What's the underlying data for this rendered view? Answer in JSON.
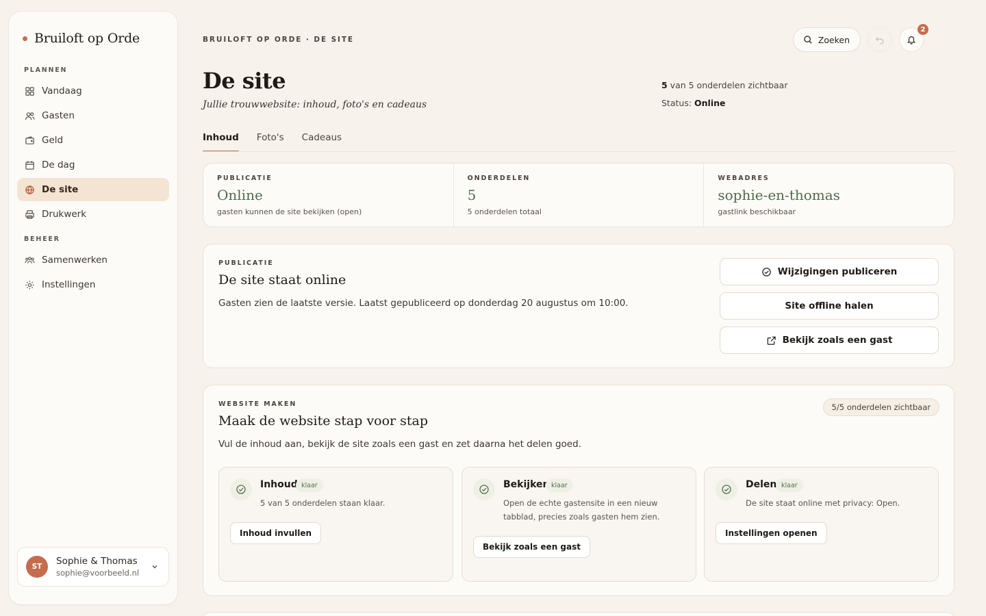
{
  "brand": {
    "name": "Bruiloft op Orde"
  },
  "sidebar": {
    "sections": [
      {
        "label": "PLANNEN",
        "items": [
          {
            "label": "Vandaag",
            "icon": "grid-icon"
          },
          {
            "label": "Gasten",
            "icon": "users-icon"
          },
          {
            "label": "Geld",
            "icon": "wallet-icon"
          },
          {
            "label": "De dag",
            "icon": "calendar-icon"
          },
          {
            "label": "De site",
            "icon": "globe-icon",
            "active": true
          },
          {
            "label": "Drukwerk",
            "icon": "printer-icon"
          }
        ]
      },
      {
        "label": "BEHEER",
        "items": [
          {
            "label": "Samenwerken",
            "icon": "team-icon"
          },
          {
            "label": "Instellingen",
            "icon": "gear-icon"
          }
        ]
      }
    ],
    "user": {
      "initials": "ST",
      "name": "Sophie & Thomas",
      "email": "sophie@voorbeeld.nl"
    }
  },
  "header": {
    "breadcrumb": "BRUILOFT OP ORDE · DE SITE",
    "title": "De site",
    "subtitle": "Jullie trouwwebsite: inhoud, foto's en cadeaus",
    "visible_count_strong": "5",
    "visible_count_rest": " van 5 onderdelen zichtbaar",
    "status_label": "Status: ",
    "status_value": "Online",
    "search_label": "Zoeken",
    "notification_count": "2"
  },
  "tabs": [
    {
      "label": "Inhoud",
      "active": true
    },
    {
      "label": "Foto's",
      "active": false
    },
    {
      "label": "Cadeaus",
      "active": false
    }
  ],
  "stats": [
    {
      "label": "PUBLICATIE",
      "value": "Online",
      "note": "gasten kunnen de site bekijken (open)"
    },
    {
      "label": "ONDERDELEN",
      "value": "5",
      "note": "5 onderdelen totaal"
    },
    {
      "label": "WEBADRES",
      "value": "sophie-en-thomas",
      "note": "gastlink beschikbaar"
    }
  ],
  "publication": {
    "label": "PUBLICATIE",
    "title": "De site staat online",
    "description": "Gasten zien de laatste versie. Laatst gepubliceerd op donderdag 20 augustus om 10:00.",
    "publish_button": "Wijzigingen publiceren",
    "offline_button": "Site offline halen",
    "preview_button": "Bekijk zoals een gast"
  },
  "builder": {
    "label": "WEBSITE MAKEN",
    "title": "Maak de website stap voor stap",
    "description": "Vul de inhoud aan, bekijk de site zoals een gast en zet daarna het delen goed.",
    "pill": "5/5 onderdelen zichtbaar",
    "steps": [
      {
        "title": "Inhoud",
        "tag": "klaar",
        "description": "5 van 5 onderdelen staan klaar.",
        "button": "Inhoud invullen"
      },
      {
        "title": "Bekijken",
        "tag": "klaar",
        "description": "Open de echte gastensite in een nieuw tabblad, precies zoals gasten hem zien.",
        "button": "Bekijk zoals een gast"
      },
      {
        "title": "Delen",
        "tag": "klaar",
        "description": "De site staat online met privacy: Open.",
        "button": "Instellingen openen"
      }
    ]
  },
  "colors": {
    "accent": "#c46d4d",
    "success": "#4e6a4a",
    "background": "#f7f3ec"
  }
}
